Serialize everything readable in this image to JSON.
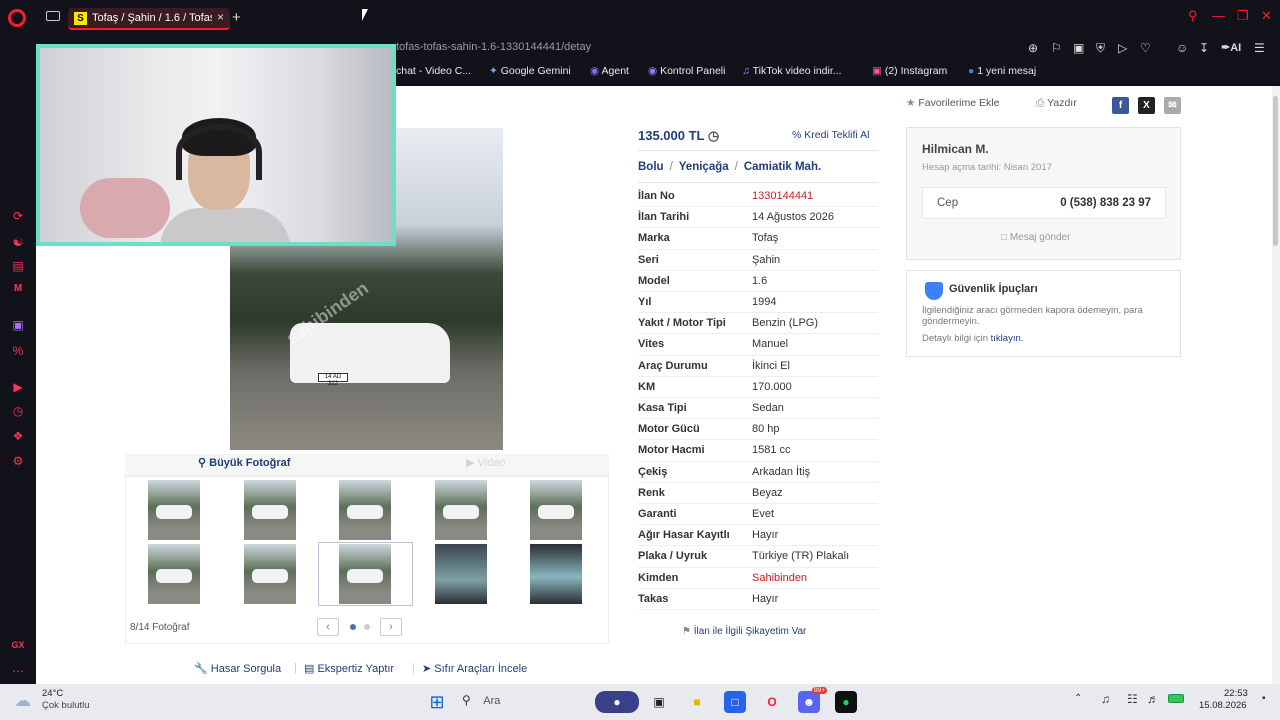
{
  "browser": {
    "tab_title": "Tofaş / Şahin / 1.6 / Tofaş Ş",
    "tab_favicon": "S",
    "url": "tofas-tofas-sahin-1.6-1330144441/detay",
    "bookmarks": [
      {
        "icon": "video-icon",
        "label": "chat - Video C..."
      },
      {
        "icon": "gemini-icon",
        "label": "Google Gemini"
      },
      {
        "icon": "agent-icon",
        "label": "Agent"
      },
      {
        "icon": "panel-icon",
        "label": "Kontrol Paneli"
      },
      {
        "icon": "tiktok-icon",
        "label": "TikTok video indir..."
      },
      {
        "icon": "instagram-icon",
        "label": "(2) Instagram"
      },
      {
        "icon": "message-icon",
        "label": "1 yeni mesaj"
      }
    ],
    "ai_label": "AI"
  },
  "page": {
    "actions": {
      "favorite": "Favorilerime Ekle",
      "print": "Yazdır"
    },
    "price": "135.000 TL",
    "credit_offer": "Kredi Teklifi Al",
    "breadcrumb": [
      "Bolu",
      "Yeniçağa",
      "Camiatik Mah."
    ],
    "details": [
      {
        "k": "İlan No",
        "v": "1330144441",
        "accent": true
      },
      {
        "k": "İlan Tarihi",
        "v": "14 Ağustos 2026"
      },
      {
        "k": "Marka",
        "v": "Tofaş"
      },
      {
        "k": "Seri",
        "v": "Şahin"
      },
      {
        "k": "Model",
        "v": "1.6"
      },
      {
        "k": "Yıl",
        "v": "1994"
      },
      {
        "k": "Yakıt / Motor Tipi",
        "v": "Benzin (LPG)"
      },
      {
        "k": "Vites",
        "v": "Manuel"
      },
      {
        "k": "Araç Durumu",
        "v": "İkinci El"
      },
      {
        "k": "KM",
        "v": "170.000"
      },
      {
        "k": "Kasa Tipi",
        "v": "Sedan"
      },
      {
        "k": "Motor Gücü",
        "v": "80 hp"
      },
      {
        "k": "Motor Hacmi",
        "v": "1581 cc"
      },
      {
        "k": "Çekiş",
        "v": "Arkadan İtiş"
      },
      {
        "k": "Renk",
        "v": "Beyaz"
      },
      {
        "k": "Garanti",
        "v": "Evet"
      },
      {
        "k": "Ağır Hasar Kayıtlı",
        "v": "Hayır"
      },
      {
        "k": "Plaka / Uyruk",
        "v": "Türkiye (TR) Plakalı"
      },
      {
        "k": "Kimden",
        "v": "Sahibinden",
        "accent": true
      },
      {
        "k": "Takas",
        "v": "Hayır"
      }
    ],
    "photo": {
      "large_photo": "Büyük Fotoğraf",
      "video": "Video",
      "counter": "8/14 Fotoğraf",
      "plate": "14 AD 312",
      "watermark": "sahibinden"
    },
    "seller": {
      "name": "Hilmican M.",
      "since": "Hesap açma tarihi: Nisan 2017",
      "phone_label": "Cep",
      "phone": "0 (538) 838 23 97",
      "message": "Mesaj gönder"
    },
    "tips": {
      "title": "Güvenlik İpuçları",
      "body": "İlgilendiğiniz aracı görmeden kapora ödemeyin, para göndermeyin.",
      "more_prefix": "Detaylı bilgi için",
      "more_link": "tıklayın."
    },
    "complaint": "İlan ile İlgili Şikayetim Var",
    "bottom_links": [
      "Hasar Sorgula",
      "Ekspertiz Yaptır",
      "Sıfır Araçları İncele"
    ]
  },
  "taskbar": {
    "weather_temp": "24°C",
    "weather_desc": "Çok bulutlu",
    "search": "Ara",
    "time": "22:53",
    "date": "15.08.2026",
    "badge": "99+"
  },
  "colors": {
    "accent": "#ff1b2d",
    "link": "#233c7a",
    "red": "#c32020",
    "webcam_border": "#6de0c4"
  }
}
